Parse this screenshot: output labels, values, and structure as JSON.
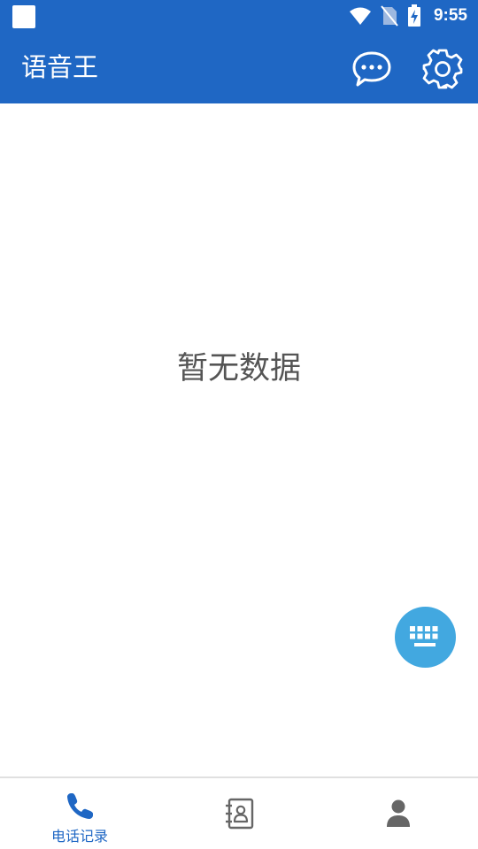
{
  "status_bar": {
    "time": "9:55",
    "icons": [
      "notification-square",
      "wifi-icon",
      "no-sim-icon",
      "battery-charging-icon"
    ]
  },
  "app_bar": {
    "title": "语音王",
    "actions": [
      "chat-bubble-icon",
      "gear-icon"
    ]
  },
  "main": {
    "empty_text": "暂无数据"
  },
  "fab": {
    "icon": "keyboard-icon"
  },
  "bottom_nav": {
    "items": [
      {
        "label": "电话记录",
        "icon": "phone-icon",
        "selected": true
      },
      {
        "label": "",
        "icon": "contacts-book-icon",
        "selected": false
      },
      {
        "label": "",
        "icon": "person-icon",
        "selected": false
      }
    ]
  },
  "colors": {
    "primary": "#1f67c4",
    "fab": "#42a8e0",
    "nav_inactive": "#666666",
    "empty_text": "#555555"
  }
}
